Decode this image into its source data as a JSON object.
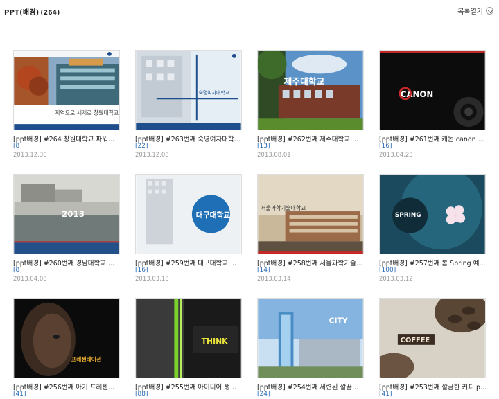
{
  "header": {
    "title": "PPT(배경)",
    "count": "(264)",
    "view_list_label": "목록열기"
  },
  "cards": [
    {
      "title": "[ppt배경] #264 창원대학교 파워...",
      "comments": "[8]",
      "date": "2013.12.30",
      "thumb": {
        "text": "지역으로 세계로 창원대학교"
      }
    },
    {
      "title": "[ppt배경] #263번째 숙명여자대학...",
      "comments": "[22]",
      "date": "2013.12.08",
      "thumb": {
        "text": "숙명여자대학교"
      }
    },
    {
      "title": "[ppt배경] #262번째 제주대학교 ...",
      "comments": "[13]",
      "date": "2013.08.01",
      "thumb": {
        "text": "제주대학교"
      }
    },
    {
      "title": "[ppt배경] #261번째 캐논 canon ...",
      "comments": "[16]",
      "date": "2013.04.23",
      "thumb": {
        "text": "CANON"
      }
    },
    {
      "title": "[ppt배경] #260번째 경남대학교 ...",
      "comments": "[8]",
      "date": "2013.04.08",
      "thumb": {
        "text": "2013"
      }
    },
    {
      "title": "[ppt배경] #259번째 대구대학교 ...",
      "comments": "[16]",
      "date": "2013.03.18",
      "thumb": {
        "text": "대구대학교"
      }
    },
    {
      "title": "[ppt배경] #258번째 서울과학기술...",
      "comments": "[14]",
      "date": "2013.03.14",
      "thumb": {
        "text": "서울과학기술대학교"
      }
    },
    {
      "title": "[ppt배경] #257번째 봄 Spring 예...",
      "comments": "[100]",
      "date": "2013.03.12",
      "thumb": {
        "text": "SPRING"
      }
    },
    {
      "title": "[ppt배경] #256번째 아기 프레젠...",
      "comments": "[41]",
      "date": "",
      "thumb": {
        "text": "프레젠테이션"
      }
    },
    {
      "title": "[ppt배경] #255번째 아이디어 생...",
      "comments": "[88]",
      "date": "",
      "thumb": {
        "text": "THINK"
      }
    },
    {
      "title": "[ppt배경] #254번째 세련된 깔끔...",
      "comments": "[24]",
      "date": "",
      "thumb": {
        "text": "CITY"
      }
    },
    {
      "title": "[ppt배경] #253번째 깔끔한 커피 p...",
      "comments": "[41]",
      "date": "",
      "thumb": {
        "text": "COFFEE"
      }
    }
  ]
}
